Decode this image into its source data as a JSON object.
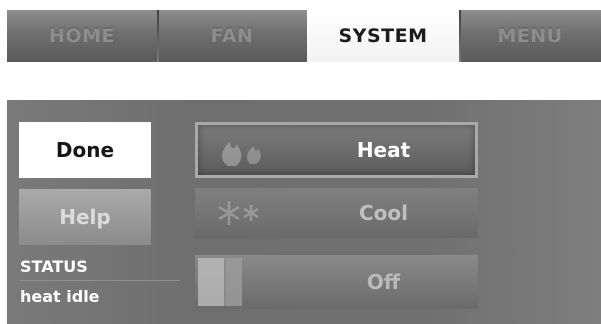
{
  "tabs": [
    {
      "label": "HOME",
      "active": false
    },
    {
      "label": "FAN",
      "active": false
    },
    {
      "label": "SYSTEM",
      "active": true
    },
    {
      "label": "MENU",
      "active": false
    }
  ],
  "buttons": {
    "done_label": "Done",
    "help_label": "Help"
  },
  "status": {
    "title": "STATUS",
    "value": "heat idle"
  },
  "modes": {
    "heat_label": "Heat",
    "cool_label": "Cool",
    "off_label": "Off",
    "selected": "Heat"
  },
  "icons": {
    "heat": "flame-icon",
    "cool": "snowflake-icon",
    "off": "power-switch-icon"
  },
  "colors": {
    "panel": "#707070",
    "active_tab": "#ffffff",
    "selected_border": "#a9a9a9"
  }
}
